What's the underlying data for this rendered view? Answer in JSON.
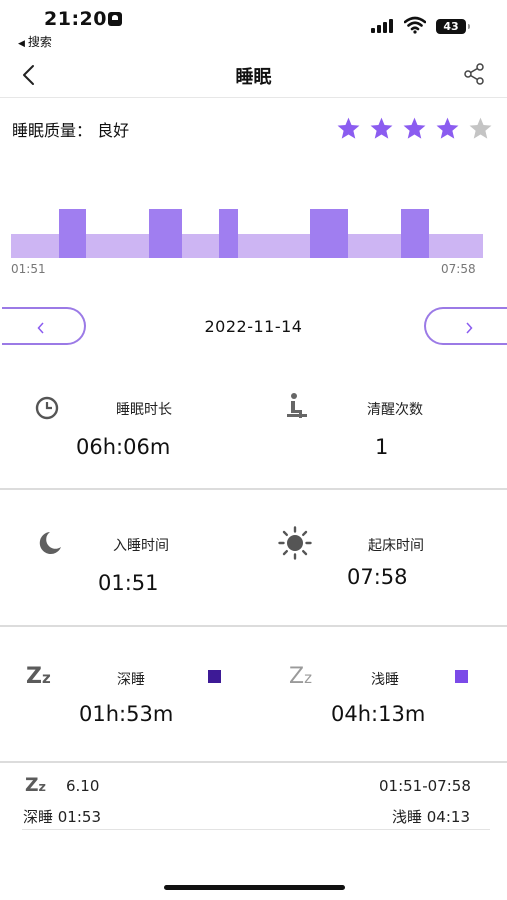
{
  "status_bar": {
    "time": "21:20",
    "back_app": "搜索",
    "battery": "43"
  },
  "nav": {
    "title": "睡眠"
  },
  "quality": {
    "label": "睡眠质量：  良好",
    "stars_total": 5,
    "stars_filled": 4,
    "star_color": "#8b5cf0",
    "star_empty_color": "#c4c4c4"
  },
  "chart": {
    "start_time": "01:51",
    "end_time": "07:58",
    "light_color": "#cdb5f3",
    "deep_color": "#a07ef0"
  },
  "date_selector": {
    "date": "2022-11-14"
  },
  "duration": {
    "label": "睡眠时长",
    "value": "06h:06m"
  },
  "wake_count": {
    "label": "清醒次数",
    "value": "1"
  },
  "sleep_time": {
    "label": "入睡时间",
    "value": "01:51"
  },
  "wake_time": {
    "label": "起床时间",
    "value": "07:58"
  },
  "deep_sleep": {
    "label": "深睡",
    "value": "01h:53m",
    "color": "#3d1a96"
  },
  "light_sleep": {
    "label": "浅睡",
    "value": "04h:13m",
    "color": "#7b4ae8"
  },
  "summary": {
    "date": "6.10",
    "range": "01:51-07:58",
    "deep": "深睡 01:53",
    "light": "浅睡 04:13"
  }
}
